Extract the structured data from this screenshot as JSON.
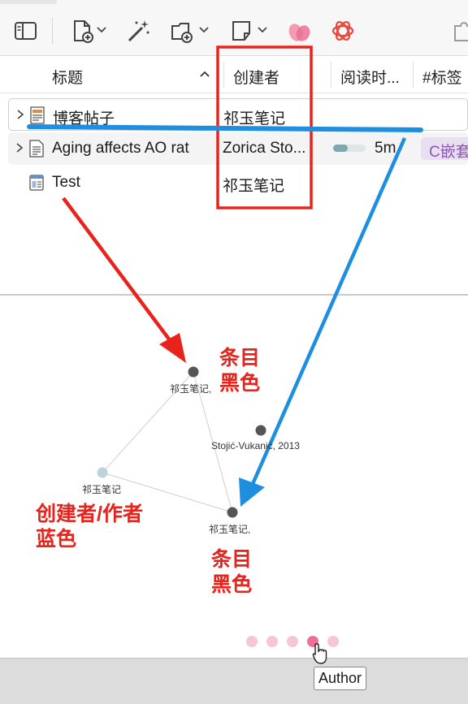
{
  "toolbar": {
    "icons": [
      "sidebar-toggle-icon",
      "new-item-icon",
      "magic-wand-icon",
      "new-collection-icon",
      "new-note-icon",
      "pink-petal-icon",
      "openai-icon",
      "puzzle-icon"
    ]
  },
  "columns": {
    "title": "标题",
    "creator": "创建者",
    "reading_time": "阅读时...",
    "tags": "#标签"
  },
  "rows": [
    {
      "title": "博客帖子",
      "creator": "祁玉笔记",
      "reading_time": "",
      "tag": ""
    },
    {
      "title": "Aging affects AO rat",
      "creator": "Zorica Sto...",
      "reading_time": "5m",
      "reading_progress": 0.45,
      "tag": "C嵌套"
    },
    {
      "title": "Test",
      "creator": "祁玉笔记",
      "reading_time": "",
      "tag": ""
    }
  ],
  "graph": {
    "nodes": [
      {
        "label": "祁玉笔记,",
        "color": "#555555"
      },
      {
        "label": "Stojić-Vukanić, 2013",
        "color": "#555555"
      },
      {
        "label": "祁玉笔记",
        "color": "#bcd4d8"
      },
      {
        "label": "祁玉笔记,",
        "color": "#555555"
      }
    ]
  },
  "annotations": {
    "item_black_1": [
      "条目",
      "黑色"
    ],
    "creator_blue": [
      "创建者/作者",
      "蓝色"
    ],
    "item_black_2": [
      "条目",
      "黑色"
    ],
    "red_color": "#e8231c",
    "blue_color": "#1e8fe0"
  },
  "pagination": {
    "count": 5,
    "active_index": 3
  },
  "tooltip": "Author"
}
